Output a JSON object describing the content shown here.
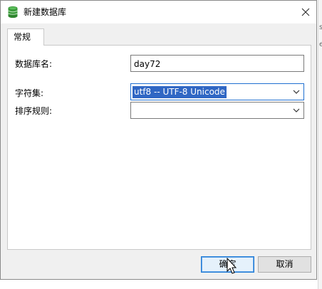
{
  "window": {
    "title": "新建数据库"
  },
  "tabs": [
    {
      "label": "常规"
    }
  ],
  "form": {
    "db_name_label": "数据库名:",
    "db_name_value": "day72",
    "charset_label": "字符集:",
    "charset_value": "utf8 -- UTF-8 Unicode",
    "collation_label": "排序规则:",
    "collation_value": ""
  },
  "buttons": {
    "ok": "确定",
    "cancel": "取消"
  },
  "background": {
    "glyph_s": "s",
    "glyph_e": "e"
  },
  "colors": {
    "selection": "#3067c4",
    "focus_border": "#1f6fd1",
    "db_icon": "#3a9a3a"
  }
}
